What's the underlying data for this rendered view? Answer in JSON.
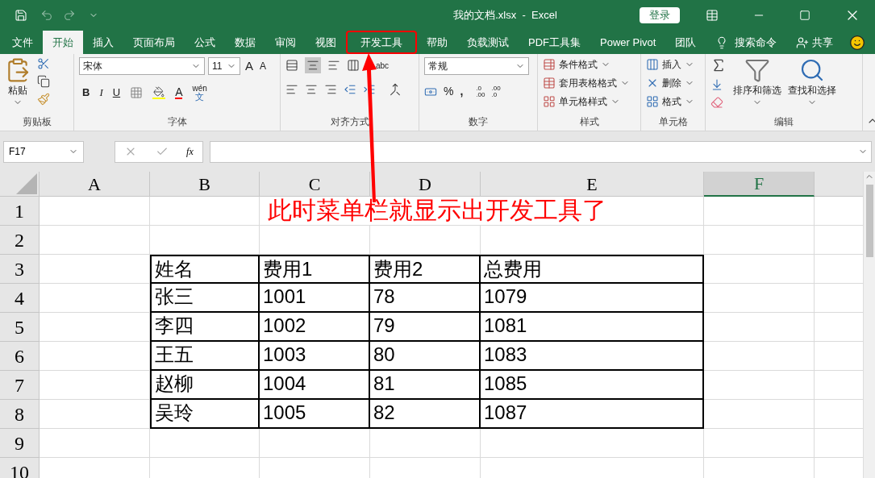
{
  "window": {
    "title": "我的文档.xlsx  -  Excel",
    "login": "登录"
  },
  "tabs": [
    {
      "label": "文件",
      "selected": false,
      "annotated": false
    },
    {
      "label": "开始",
      "selected": true,
      "annotated": false
    },
    {
      "label": "插入",
      "selected": false,
      "annotated": false
    },
    {
      "label": "页面布局",
      "selected": false,
      "annotated": false
    },
    {
      "label": "公式",
      "selected": false,
      "annotated": false
    },
    {
      "label": "数据",
      "selected": false,
      "annotated": false
    },
    {
      "label": "审阅",
      "selected": false,
      "annotated": false
    },
    {
      "label": "视图",
      "selected": false,
      "annotated": false
    },
    {
      "label": "开发工具",
      "selected": false,
      "annotated": true
    },
    {
      "label": "帮助",
      "selected": false,
      "annotated": false
    },
    {
      "label": "负载测试",
      "selected": false,
      "annotated": false
    },
    {
      "label": "PDF工具集",
      "selected": false,
      "annotated": false
    },
    {
      "label": "Power Pivot",
      "selected": false,
      "annotated": false
    },
    {
      "label": "团队",
      "selected": false,
      "annotated": false
    }
  ],
  "search": "搜索命令",
  "share": "共享",
  "ribbon": {
    "clipboard": {
      "paste": "粘贴",
      "label": "剪贴板"
    },
    "font": {
      "name": "宋体",
      "size": "11",
      "grow": "A",
      "shrink": "A",
      "bold": "B",
      "italic": "I",
      "underline": "U",
      "color_letter": "A",
      "phonetic": "wén",
      "phonetic_char": "文",
      "label": "字体"
    },
    "alignment": {
      "wrap": "abc",
      "label": "对齐方式"
    },
    "number": {
      "format": "常规",
      "percent": "%",
      "comma": ",",
      "increase": [
        ".0",
        ".00"
      ],
      "decrease": [
        ".00",
        ".0"
      ],
      "label": "数字"
    },
    "styles": {
      "items": [
        "条件格式",
        "套用表格格式",
        "单元格样式"
      ],
      "label": "样式"
    },
    "cells": {
      "items": [
        "插入",
        "删除",
        "格式"
      ],
      "label": "单元格"
    },
    "editing": {
      "sort": "排序和筛选",
      "find": "查找和选择",
      "label": "编辑"
    }
  },
  "formula_bar": {
    "name_box": "F17",
    "fx": "fx"
  },
  "columns": [
    {
      "label": "A",
      "selected": false
    },
    {
      "label": "B",
      "selected": false
    },
    {
      "label": "C",
      "selected": false
    },
    {
      "label": "D",
      "selected": false
    },
    {
      "label": "E",
      "selected": false
    },
    {
      "label": "F",
      "selected": true
    }
  ],
  "rows": [
    "1",
    "2",
    "3",
    "4",
    "5",
    "6",
    "7",
    "8",
    "9",
    "10"
  ],
  "table": {
    "rows": [
      [
        "姓名",
        "费用1",
        "费用2",
        "总费用"
      ],
      [
        "张三",
        "1001",
        "78",
        "1079"
      ],
      [
        "李四",
        "1002",
        "79",
        "1081"
      ],
      [
        "王五",
        "1003",
        "80",
        "1083"
      ],
      [
        "赵柳",
        "1004",
        "81",
        "1085"
      ],
      [
        "吴玲",
        "1005",
        "82",
        "1087"
      ]
    ]
  },
  "annotation": {
    "text": "此时菜单栏就显示出开发工具了"
  }
}
